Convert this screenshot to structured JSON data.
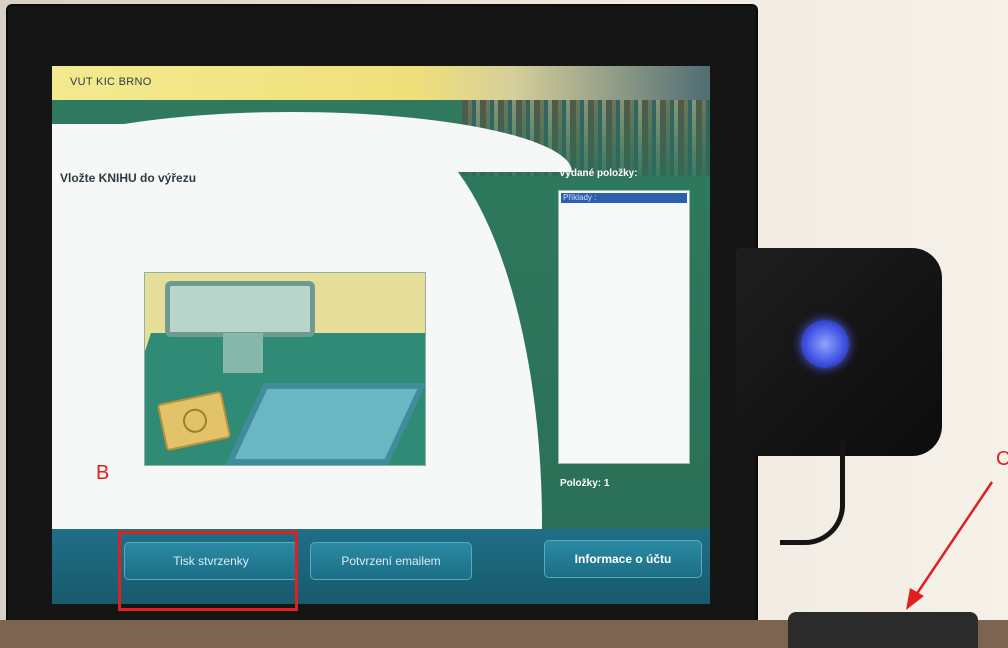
{
  "header": {
    "title": "VUT KIC BRNO"
  },
  "main": {
    "instruction": "Vložte KNIHU do výřezu"
  },
  "issued": {
    "title": "Vydané položky:",
    "items": [
      "Příklady :"
    ],
    "count_label": "Položky: 1"
  },
  "buttons": {
    "receipt": "Tisk stvrzenky",
    "email": "Potvrzení emailem",
    "account": "Informace o účtu"
  },
  "annotations": {
    "b": "B",
    "c": "C"
  },
  "colors": {
    "header": "#efe07a",
    "screen_green": "#2c6f57",
    "bottom_bar": "#1f6f86",
    "selected_item": "#2c5fb0",
    "annotation": "#e02020",
    "reader_light": "#3c4dde"
  },
  "icons": {
    "reader_light": "rfid-light-icon",
    "book": "book-icon"
  }
}
